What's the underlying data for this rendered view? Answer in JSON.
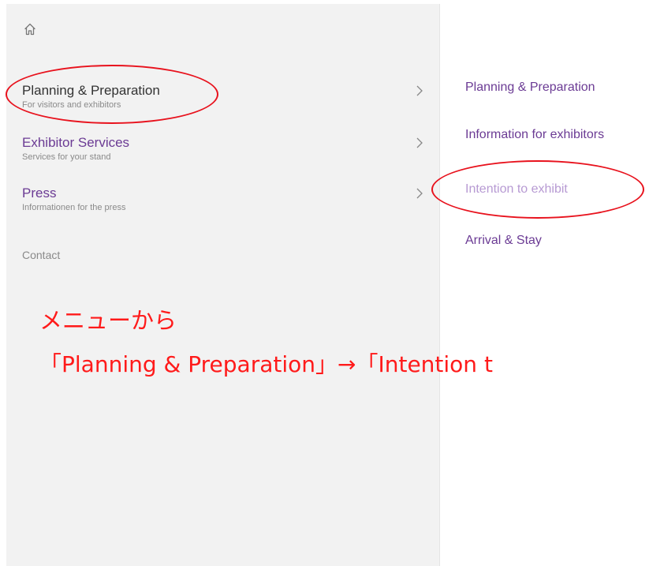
{
  "nav": {
    "home_icon": "home-icon",
    "items": [
      {
        "title": "Planning & Preparation",
        "subtitle": "For visitors and exhibitors",
        "icon": "chevron-right-icon"
      },
      {
        "title": "Exhibitor Services",
        "subtitle": "Services for your stand",
        "icon": "chevron-right-icon"
      },
      {
        "title": "Press",
        "subtitle": "Informationen for the press",
        "icon": "chevron-right-icon"
      }
    ],
    "contact": "Contact"
  },
  "submenu": {
    "items": [
      {
        "label": "Planning & Preparation"
      },
      {
        "label": "Information for exhibitors"
      },
      {
        "label": "Intention to exhibit"
      },
      {
        "label": "Arrival & Stay"
      }
    ]
  },
  "annotation": {
    "line1": "メニューから",
    "line2": "「Planning & Preparation」→「Intention t"
  },
  "colors": {
    "accent": "#6b3b94",
    "accent_muted": "#b79ad3",
    "annotation": "#ff1a1a",
    "panel_bg": "#f2f2f2"
  }
}
